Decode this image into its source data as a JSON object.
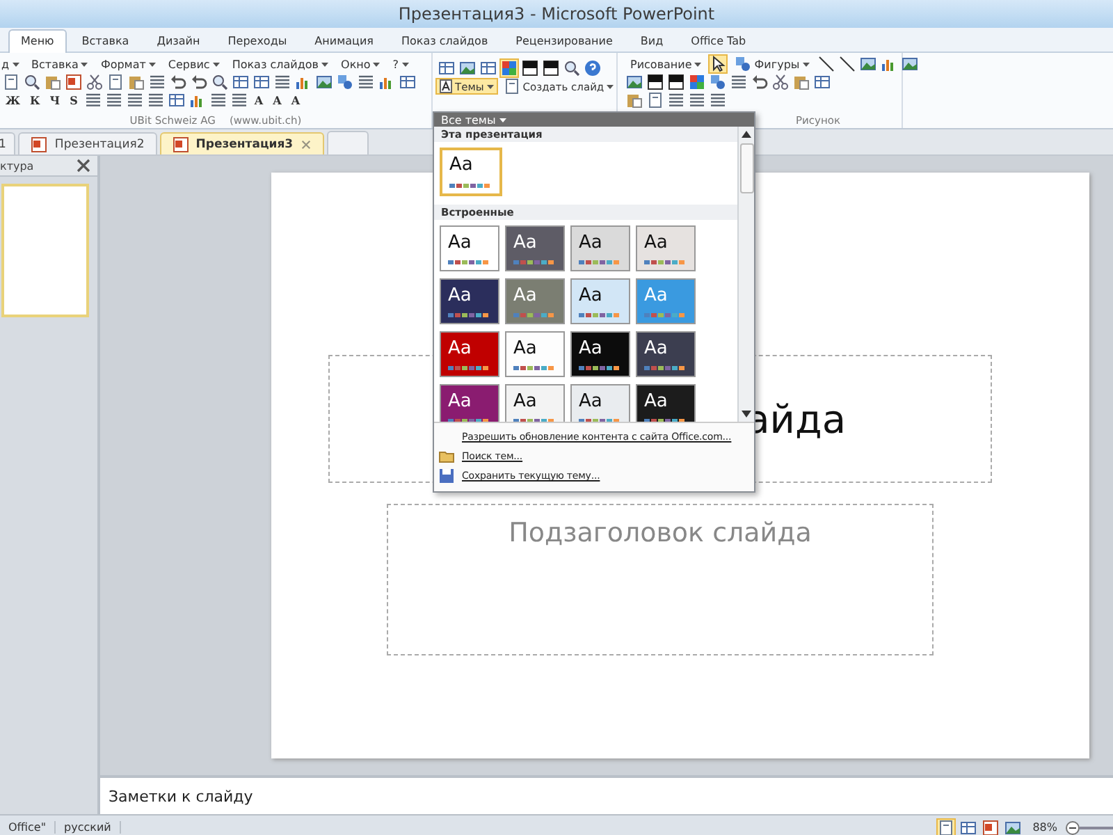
{
  "window": {
    "title": "Презентация3 - Microsoft PowerPoint"
  },
  "ribbon_tabs": [
    {
      "label": "Меню",
      "selected": true
    },
    {
      "label": "Вставка",
      "selected": false
    },
    {
      "label": "Дизайн",
      "selected": false
    },
    {
      "label": "Переходы",
      "selected": false
    },
    {
      "label": "Анимация",
      "selected": false
    },
    {
      "label": "Показ слайдов",
      "selected": false
    },
    {
      "label": "Рецензирование",
      "selected": false
    },
    {
      "label": "Вид",
      "selected": false
    },
    {
      "label": "Office Tab",
      "selected": false
    }
  ],
  "menu_bar": [
    "д",
    "Вставка",
    "Формат",
    "Сервис",
    "Показ слайдов",
    "Окно",
    "?"
  ],
  "format_buttons": [
    "Ж",
    "К",
    "Ч",
    "S"
  ],
  "font_buttons": [
    "A",
    "A",
    "A"
  ],
  "themes_button": "Темы",
  "new_slide_button": "Создать слайд",
  "drawing_menu": "Рисование",
  "shapes_button": "Фигуры",
  "group_labels": [
    "UBit Schweiz AG",
    "(www.ubit.ch)",
    "Рисунок"
  ],
  "document_tabs": [
    {
      "label": "1",
      "selected": false
    },
    {
      "label": "Презентация2",
      "selected": false
    },
    {
      "label": "Презентация3",
      "selected": true
    }
  ],
  "left_pane": {
    "title": "ктура"
  },
  "slide": {
    "title": "айда",
    "subtitle": "Подзаголовок слайда"
  },
  "notes": {
    "text": "Заметки к слайду"
  },
  "theme_gallery": {
    "filter": "Все темы",
    "sections": [
      {
        "title": "Эта презентация",
        "themes": [
          {
            "label": "Aa",
            "color": "#ffffff",
            "selected": true
          }
        ]
      },
      {
        "title": "Встроенные",
        "themes": [
          {
            "label": "Aa",
            "color": "#ffffff",
            "selected": false
          },
          {
            "label": "Aa",
            "color": "#5e5c66",
            "selected": false
          },
          {
            "label": "Aa",
            "color": "#dadada",
            "selected": false
          },
          {
            "label": "Aa",
            "color": "#e6e2e0",
            "selected": false
          },
          {
            "label": "Aa",
            "color": "#2b2e5c",
            "selected": false
          },
          {
            "label": "Aa",
            "color": "#7b7e72",
            "selected": false
          },
          {
            "label": "Aa",
            "color": "#d2e6f6",
            "selected": false
          },
          {
            "label": "Aa",
            "color": "#3a9ae0",
            "selected": false
          },
          {
            "label": "Aa",
            "color": "#c00000",
            "selected": false
          },
          {
            "label": "Aa",
            "color": "#fdfdfd",
            "selected": false
          },
          {
            "label": "Aa",
            "color": "#0c0c0c",
            "selected": false
          },
          {
            "label": "Aa",
            "color": "#3c3e50",
            "selected": false
          },
          {
            "label": "Aa",
            "color": "#8a1c70",
            "selected": false
          },
          {
            "label": "Aa",
            "color": "#f3f3f3",
            "selected": false
          },
          {
            "label": "Aa",
            "color": "#e9ecef",
            "selected": false
          },
          {
            "label": "Aa",
            "color": "#1c1c1c",
            "selected": false
          }
        ]
      }
    ],
    "actions": [
      "Разрешить обновление контента с сайта Office.com...",
      "Поиск тем...",
      "Сохранить текущую тему..."
    ]
  },
  "status_bar": {
    "theme": "Office\"",
    "language": "русский",
    "zoom": "88%"
  }
}
